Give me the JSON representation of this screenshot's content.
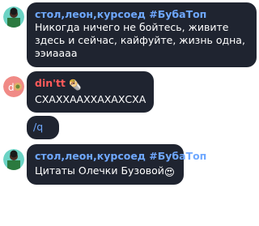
{
  "messages": [
    {
      "sender": "стол,леон,курсоед #БубаТоп",
      "sender_color": "#6fa8ff",
      "lines": [
        "Никогда ничего не бойтесь, живите",
        "здесь и сейчас, кайфуйте, жизнь одна,",
        "ээиаааа"
      ]
    },
    {
      "sender": "din'tt",
      "sender_color": "#ff5a5a",
      "sender_emoji": "🌯",
      "text": "СХАХХААХХАХАХСХА"
    },
    {
      "text": "/q",
      "text_color": "#6fa8ff"
    },
    {
      "sender": "стол,леон,курсоед #БубаТоп",
      "sender_color": "#6fa8ff",
      "text": "Цитаты Олечки Бузовой",
      "text_emoji": "😍"
    }
  ],
  "colors": {
    "bubble": "#1f2430",
    "page_background": "#ffffff"
  }
}
